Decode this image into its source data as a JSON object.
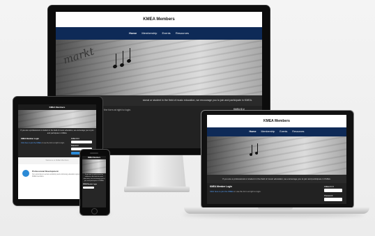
{
  "site": {
    "title": "KMEA Members",
    "nav": [
      "Home",
      "Membership",
      "Events",
      "Resources"
    ],
    "intro": "If you are a professional or student in the field of music education, we encourage you to join and participate in KMEA.",
    "intro_fragment": "sional or student in the field of music education, we encourage you to join and participate in KMEA.",
    "login_title": "KMEA Member Login",
    "login_prompt": "Use the form at right to login.",
    "login_link": "Click here to join the KMEA",
    "login_link_rest": "or use the form at right to login.",
    "username_label": "KMEA ID #",
    "password_label": "Password",
    "hero_word": "markt"
  },
  "tablet": {
    "section_title": "Professional Development",
    "section_text": "Our upcoming in-service workshop and continuing education opportunities for KMEA members.",
    "welcome": "Welcome to KMEA Members"
  },
  "colors": {
    "nav": "#0e2a57",
    "link": "#59a3ff",
    "accent": "#2b8ad6"
  }
}
